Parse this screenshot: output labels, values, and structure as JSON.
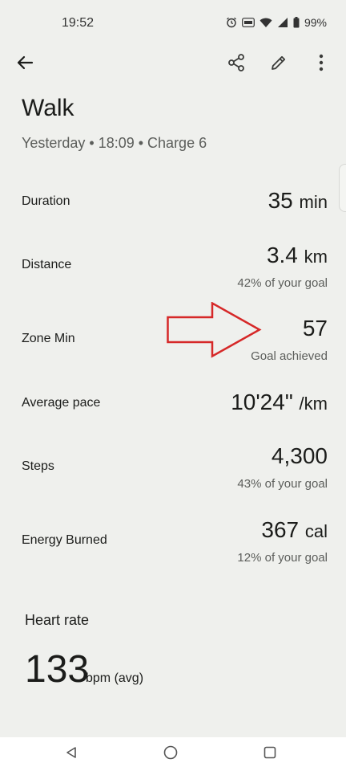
{
  "status_bar": {
    "time": "19:52",
    "battery": "99%",
    "icons": [
      "alarm-icon",
      "volte-icon",
      "wifi-icon",
      "signal-icon",
      "battery-icon"
    ]
  },
  "app_bar": {
    "icons": [
      "back-arrow-icon",
      "share-icon",
      "edit-pencil-icon",
      "more-vert-icon"
    ]
  },
  "activity": {
    "title": "Walk",
    "subtitle": "Yesterday • 18:09 • Charge 6"
  },
  "stats": {
    "duration": {
      "label": "Duration",
      "value": "35",
      "unit": "min"
    },
    "distance": {
      "label": "Distance",
      "value": "3.4",
      "unit": "km",
      "sub": "42% of your goal"
    },
    "zone_min": {
      "label": "Zone Min",
      "value": "57",
      "sub": "Goal achieved"
    },
    "average_pace": {
      "label": "Average pace",
      "value": "10'24\"",
      "unit": "/km"
    },
    "steps": {
      "label": "Steps",
      "value": "4,300",
      "sub": "43% of your goal"
    },
    "energy": {
      "label": "Energy Burned",
      "value": "367",
      "unit": "cal",
      "sub": "12% of your goal"
    }
  },
  "heart_rate": {
    "title": "Heart rate",
    "value": "133",
    "unit": "bpm (avg)"
  },
  "annotation": {
    "arrow_color": "#d62828"
  },
  "nav_bar": {
    "icons": [
      "nav-back-icon",
      "nav-home-icon",
      "nav-recents-icon"
    ]
  }
}
